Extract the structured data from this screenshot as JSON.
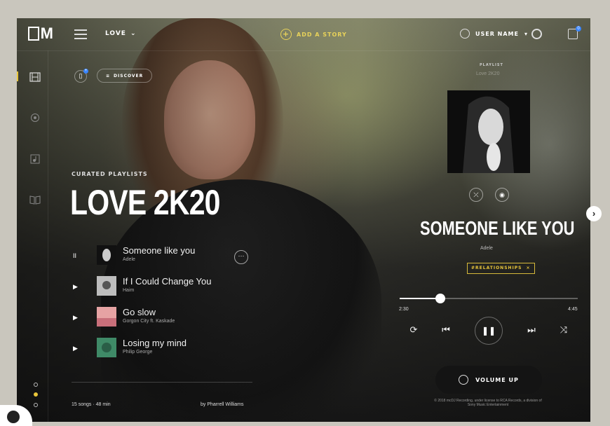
{
  "header": {
    "logo_text": "M",
    "menu": "LOVE",
    "add_story": "ADD A STORY",
    "user_name": "USER NAME",
    "notification_count": "0"
  },
  "sidebar": {
    "items": [
      {
        "icon": "film-icon",
        "active": true
      },
      {
        "icon": "podcast-icon",
        "active": false
      },
      {
        "icon": "music-note-icon",
        "active": false
      },
      {
        "icon": "book-icon",
        "active": false
      }
    ],
    "page_dots": [
      false,
      true,
      false
    ]
  },
  "toolbar": {
    "discover": "DISCOVER"
  },
  "playlist": {
    "kicker": "CURATED PLAYLISTS",
    "title": "LOVE 2K20",
    "tracks": [
      {
        "title": "Someone like you",
        "artist": "Adele",
        "state": "pause",
        "ctrl": "II"
      },
      {
        "title": "If I Could Change You",
        "artist": "Haim",
        "state": "play",
        "ctrl": "▶"
      },
      {
        "title": "Go slow",
        "artist": "Gorgon City ft. Kaskade",
        "state": "play",
        "ctrl": "▶"
      },
      {
        "title": "Losing my mind",
        "artist": "Philip George",
        "state": "play",
        "ctrl": "▶"
      }
    ],
    "summary": "15 songs · 48 min",
    "curator": "by Pharrell Williams"
  },
  "now_playing": {
    "label": "PLAYLIST",
    "sublabel": "Love 2K20",
    "title": "SOMEONE LIKE YOU",
    "artist": "Adele",
    "tag": "#RELATIONSHIPS",
    "tag_close": "×",
    "elapsed": "2:30",
    "duration": "4:45",
    "progress": 0.23,
    "volume_label": "VOLUME UP",
    "copyright": "© 2018 mcDJ Recording, under license to RCA Records, a division of Sony Music Entertainment"
  },
  "colors": {
    "accent": "#e8c53a",
    "badge": "#3a86ff"
  }
}
